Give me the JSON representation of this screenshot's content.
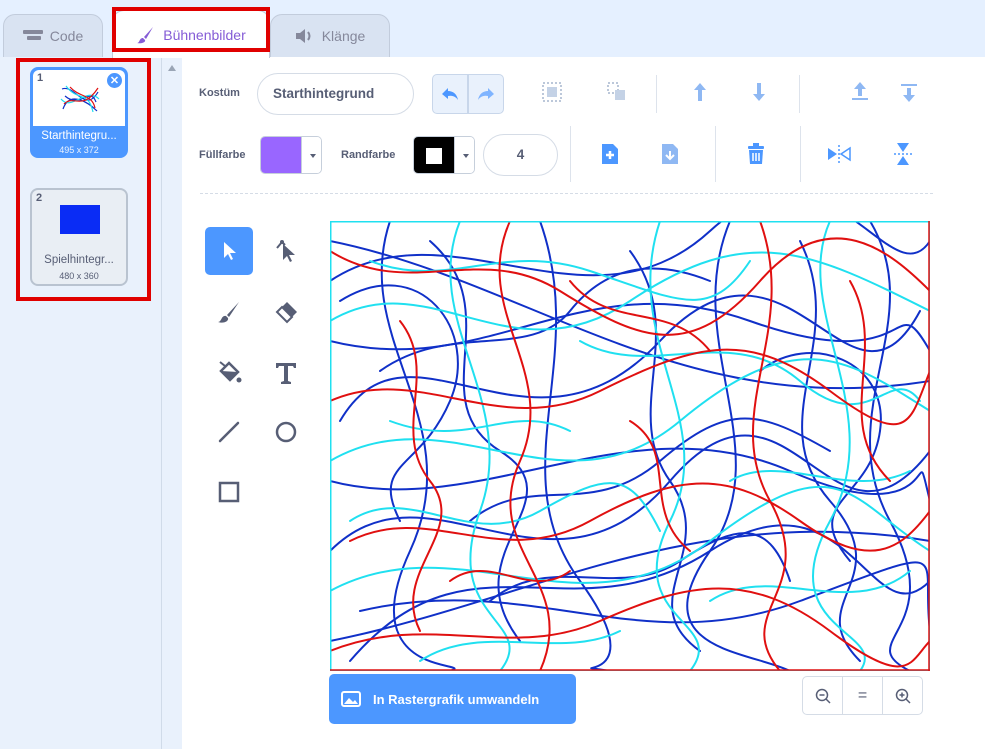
{
  "tabs": [
    {
      "label": "Code",
      "icon": "code-icon"
    },
    {
      "label": "Bühnenbilder",
      "icon": "brush-icon"
    },
    {
      "label": "Klänge",
      "icon": "speaker-icon"
    }
  ],
  "backdrops": [
    {
      "number": "1",
      "name": "Starthintegru...",
      "size": "495 x 372",
      "selected": true
    },
    {
      "number": "2",
      "name": "Spielhintegr...",
      "size": "480 x 360",
      "selected": false,
      "thumbnail_color": "#0a2cf5"
    }
  ],
  "editor": {
    "costume_label": "Kostüm",
    "costume_name": "Starthintegrund",
    "fill_label": "Füllfarbe",
    "fill_color": "#9966ff",
    "outline_label": "Randfarbe",
    "outline_color": "#000000",
    "stroke_width": "4",
    "convert_label": "In Rastergrafik umwandeln"
  },
  "tools": [
    "select-tool",
    "reshape-tool",
    "brush-tool",
    "eraser-tool",
    "fill-tool",
    "text-tool",
    "line-tool",
    "circle-tool",
    "rectangle-tool"
  ],
  "zoom": {
    "out": "−",
    "reset": "=",
    "in": "+"
  },
  "colors": {
    "accent": "#4c97ff",
    "highlight": "#e00000",
    "scribble_red": "#e01010",
    "scribble_blue": "#1030c8",
    "scribble_cyan": "#20e0f0"
  }
}
